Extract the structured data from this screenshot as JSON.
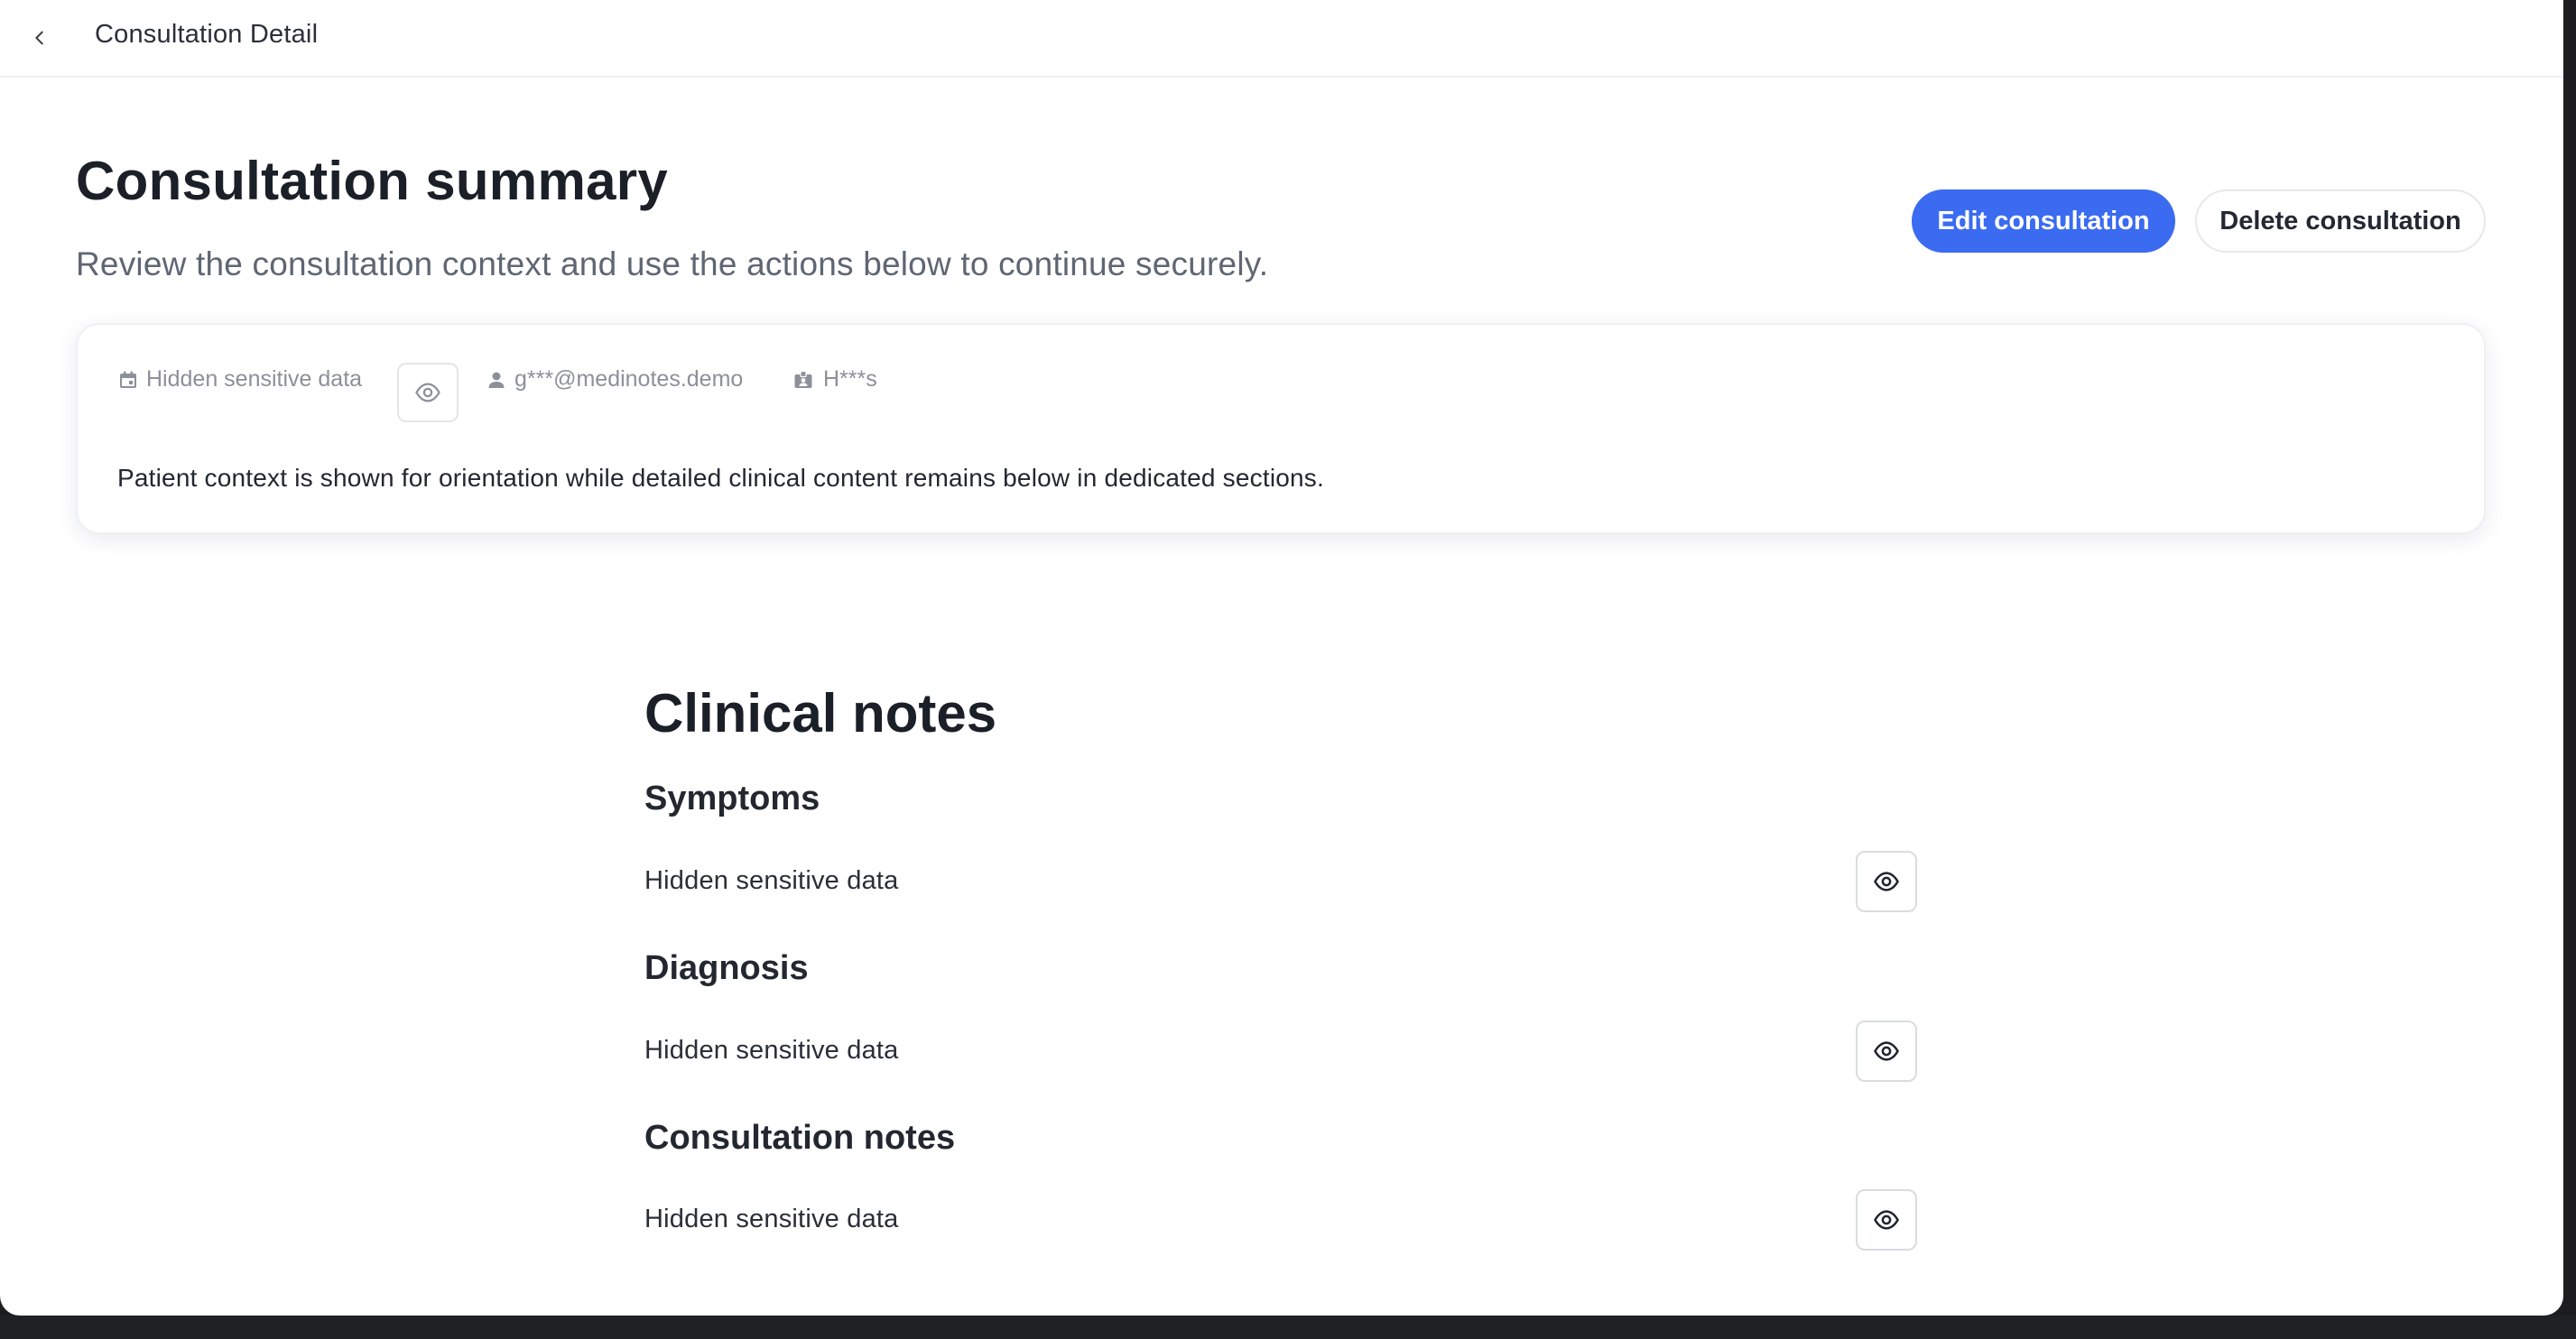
{
  "topbar": {
    "back_icon": "chevron-left-icon",
    "title": "Consultation Detail"
  },
  "header": {
    "title": "Consultation summary",
    "subtitle": "Review the consultation context and use the actions below to continue securely.",
    "edit_label": "Edit consultation",
    "delete_label": "Delete consultation",
    "accent_color": "#3a6bf0"
  },
  "context_card": {
    "date_icon": "calendar-icon",
    "date_value": "Hidden sensitive data",
    "reveal_icon": "eye-icon",
    "user_icon": "person-icon",
    "email": "g***@medinotes.demo",
    "code_icon": "id-badge-icon",
    "code": "H***s",
    "description": "Patient context is shown for orientation while detailed clinical content remains below in dedicated sections."
  },
  "clinical_notes": {
    "title": "Clinical notes",
    "sections": [
      {
        "title": "Symptoms",
        "value": "Hidden sensitive data",
        "icon": "eye-icon"
      },
      {
        "title": "Diagnosis",
        "value": "Hidden sensitive data",
        "icon": "eye-icon"
      },
      {
        "title": "Consultation notes",
        "value": "Hidden sensitive data",
        "icon": "eye-icon"
      }
    ]
  }
}
